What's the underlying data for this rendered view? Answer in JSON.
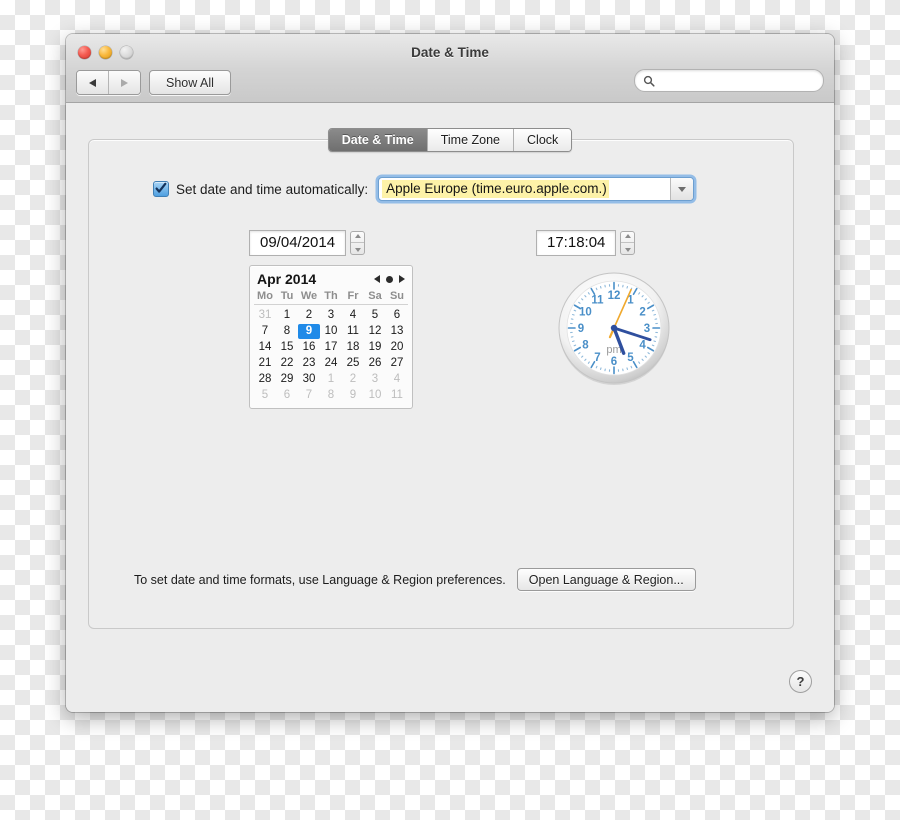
{
  "window": {
    "title": "Date & Time",
    "traffic_lights": [
      "close",
      "minimize",
      "zoom"
    ]
  },
  "toolbar": {
    "back_icon": "triangle-left-icon",
    "forward_icon": "triangle-right-icon",
    "show_all_label": "Show All",
    "search_placeholder": "",
    "search_value": "",
    "search_icon": "search-icon"
  },
  "tabs": [
    {
      "label": "Date & Time",
      "active": true
    },
    {
      "label": "Time Zone",
      "active": false
    },
    {
      "label": "Clock",
      "active": false
    }
  ],
  "auto_row": {
    "checkbox_checked": true,
    "label": "Set date and time automatically:",
    "server_value": "Apple Europe (time.euro.apple.com.)",
    "dropdown_icon": "chevron-down-icon",
    "highlight_color": "#fdf2a8",
    "focus_ring_color": "#76ace4"
  },
  "date_panel": {
    "date_value": "09/04/2014",
    "stepper_icon": "stepper-updown-icon",
    "calendar": {
      "month_label": "Apr 2014",
      "prev_icon": "triangle-left-icon",
      "today_icon": "dot-icon",
      "next_icon": "triangle-right-icon",
      "weekdays": [
        "Mo",
        "Tu",
        "We",
        "Th",
        "Fr",
        "Sa",
        "Su"
      ],
      "selected_day": 9,
      "selection_color": "#1f8ae8",
      "weeks": [
        [
          {
            "d": "31",
            "m": true
          },
          {
            "d": "1",
            "m": false
          },
          {
            "d": "2",
            "m": false
          },
          {
            "d": "3",
            "m": false
          },
          {
            "d": "4",
            "m": false
          },
          {
            "d": "5",
            "m": false
          },
          {
            "d": "6",
            "m": false
          }
        ],
        [
          {
            "d": "7",
            "m": false
          },
          {
            "d": "8",
            "m": false
          },
          {
            "d": "9",
            "m": false,
            "s": true
          },
          {
            "d": "10",
            "m": false
          },
          {
            "d": "11",
            "m": false
          },
          {
            "d": "12",
            "m": false
          },
          {
            "d": "13",
            "m": false
          }
        ],
        [
          {
            "d": "14",
            "m": false
          },
          {
            "d": "15",
            "m": false
          },
          {
            "d": "16",
            "m": false
          },
          {
            "d": "17",
            "m": false
          },
          {
            "d": "18",
            "m": false
          },
          {
            "d": "19",
            "m": false
          },
          {
            "d": "20",
            "m": false
          }
        ],
        [
          {
            "d": "21",
            "m": false
          },
          {
            "d": "22",
            "m": false
          },
          {
            "d": "23",
            "m": false
          },
          {
            "d": "24",
            "m": false
          },
          {
            "d": "25",
            "m": false
          },
          {
            "d": "26",
            "m": false
          },
          {
            "d": "27",
            "m": false
          }
        ],
        [
          {
            "d": "28",
            "m": false
          },
          {
            "d": "29",
            "m": false
          },
          {
            "d": "30",
            "m": false
          },
          {
            "d": "1",
            "m": true
          },
          {
            "d": "2",
            "m": true
          },
          {
            "d": "3",
            "m": true
          },
          {
            "d": "4",
            "m": true
          }
        ],
        [
          {
            "d": "5",
            "m": true
          },
          {
            "d": "6",
            "m": true
          },
          {
            "d": "7",
            "m": true
          },
          {
            "d": "8",
            "m": true
          },
          {
            "d": "9",
            "m": true
          },
          {
            "d": "10",
            "m": true
          },
          {
            "d": "11",
            "m": true
          }
        ]
      ]
    }
  },
  "time_panel": {
    "time_value": "17:18:04",
    "stepper_icon": "stepper-updown-icon",
    "clock": {
      "meridiem_label": "pm",
      "hour": 5,
      "minute": 18,
      "second": 4,
      "numerals": [
        "12",
        "1",
        "2",
        "3",
        "4",
        "5",
        "6",
        "7",
        "8",
        "9",
        "10",
        "11"
      ],
      "numeral_color": "#4a8fc8",
      "hand_color": "#2f4f9e",
      "second_hand_color": "#f0a92e"
    }
  },
  "footer": {
    "note": "To set date and time formats, use Language & Region preferences.",
    "open_button_label": "Open Language & Region...",
    "help_label": "?"
  }
}
